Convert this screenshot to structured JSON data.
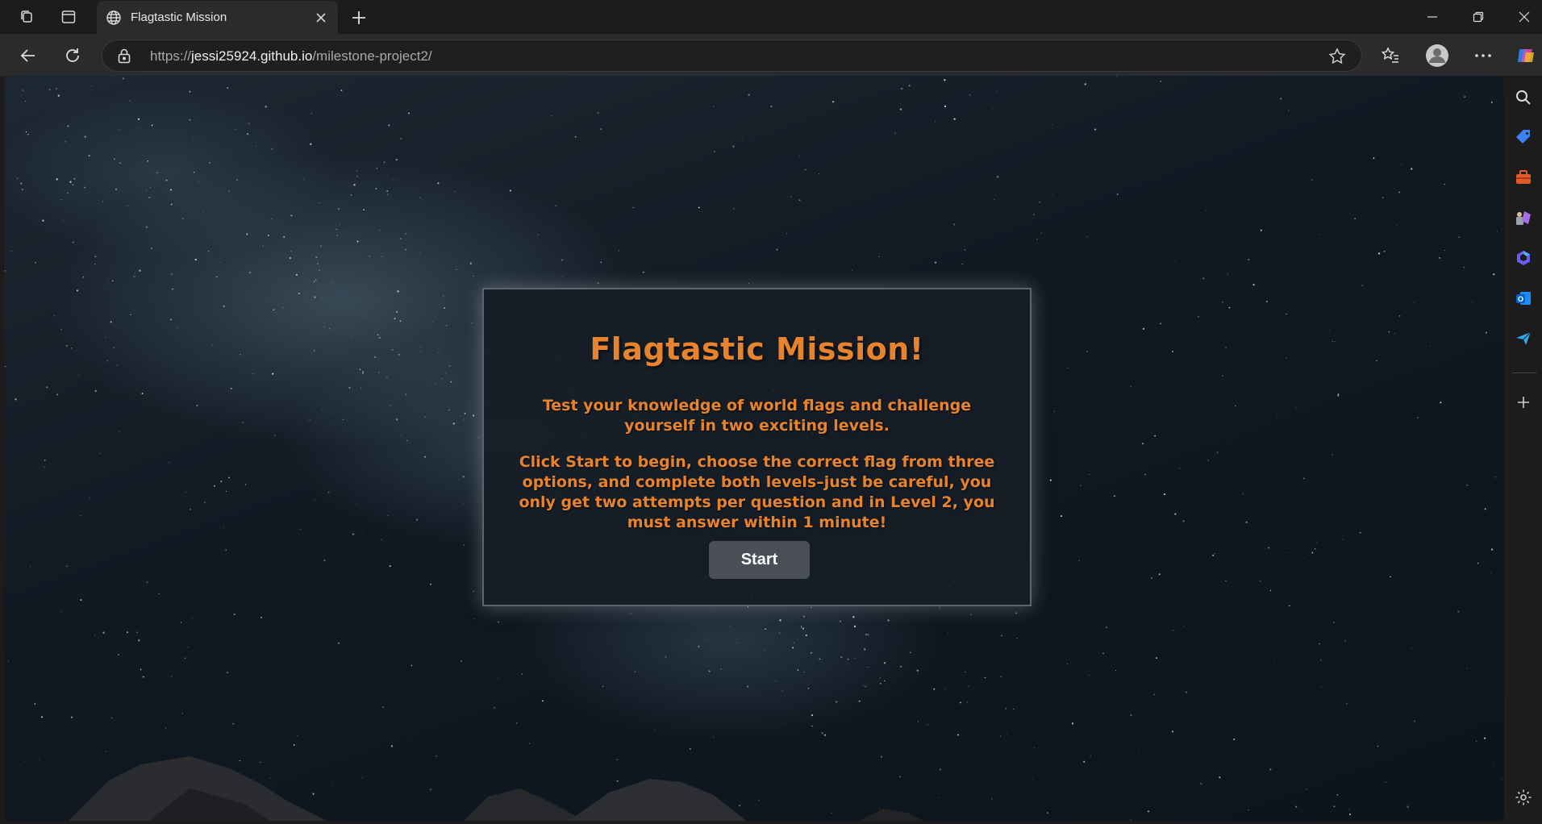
{
  "browser": {
    "tab": {
      "title": "Flagtastic Mission",
      "icon": "globe-icon"
    },
    "address": {
      "scheme": "https://",
      "host": "jessi25924.github.io",
      "path": "/milestone-project2/"
    },
    "toolbar_icons": [
      "back-icon",
      "refresh-icon",
      "favorites-star-icon",
      "favorites-list-icon",
      "profile-icon",
      "more-icon",
      "copilot-icon"
    ],
    "sidebar_icons": [
      "search-icon",
      "shopping-tag-icon",
      "toolbox-icon",
      "games-icon",
      "copilot-app-icon",
      "outlook-icon",
      "send-icon",
      "add-icon",
      "settings-icon"
    ]
  },
  "page": {
    "title": "Flagtastic Mission!",
    "intro": "Test your knowledge of world flags and challenge yourself in two exciting levels.",
    "instructions": "Click Start to begin, choose the correct flag from three options, and complete both levels–just be careful, you only get two attempts per question and in Level 2, you must answer within 1 minute!",
    "start_label": "Start"
  },
  "colors": {
    "accent": "#e8832d",
    "card_bg": "#161d26",
    "button_bg": "#4a4f57"
  }
}
